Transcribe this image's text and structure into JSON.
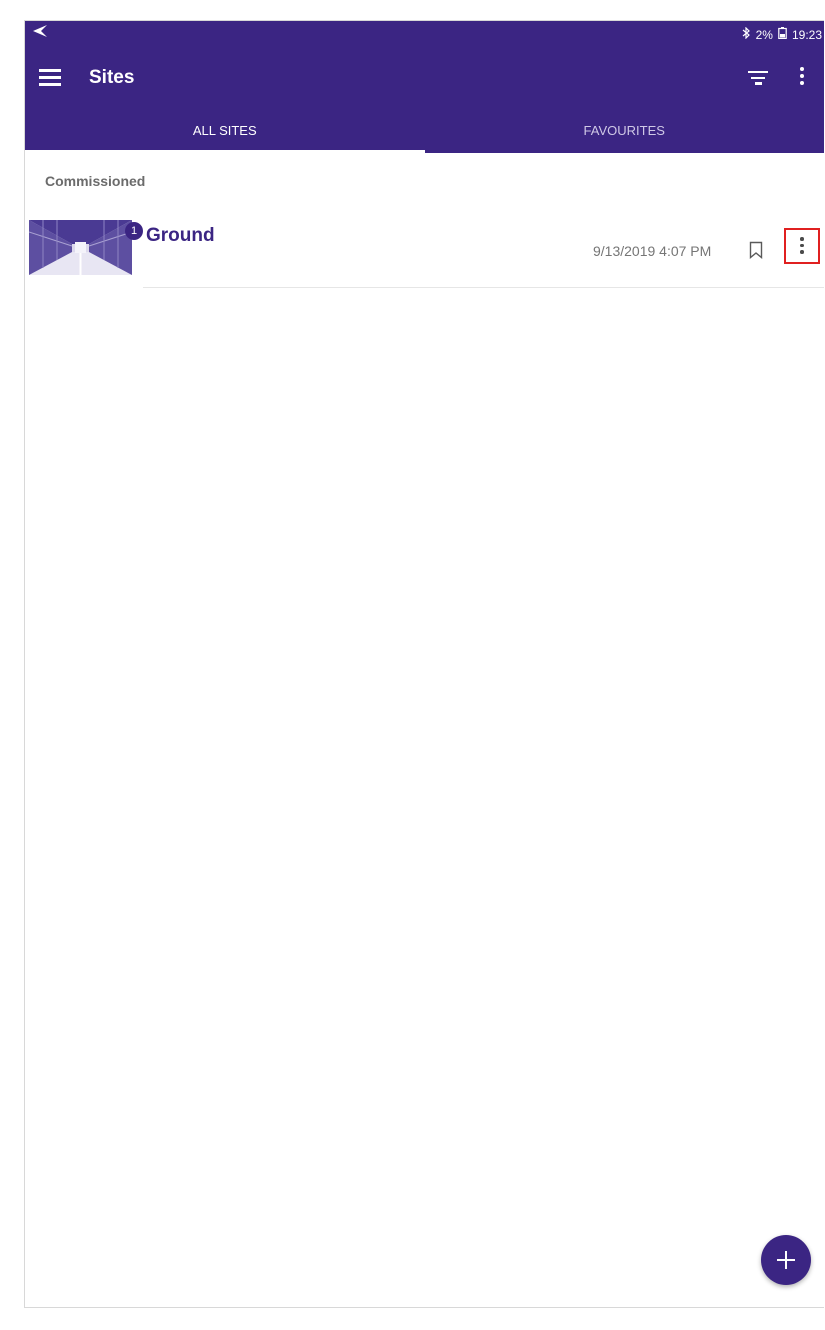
{
  "status_bar": {
    "battery": "2%",
    "time": "19:23",
    "icons": [
      "navigation-icon",
      "bluetooth-icon",
      "battery-icon"
    ]
  },
  "toolbar": {
    "title": "Sites",
    "icons": [
      "menu-icon",
      "filter-icon",
      "overflow-icon"
    ]
  },
  "tabs": [
    {
      "label": "ALL SITES",
      "active": true
    },
    {
      "label": "FAVOURITES",
      "active": false
    }
  ],
  "section": {
    "header": "Commissioned"
  },
  "sites": [
    {
      "name": "Ground",
      "badge": "1",
      "date": "9/13/2019 4:07 PM",
      "icons": [
        "bookmark-icon",
        "more-vert-icon"
      ]
    }
  ],
  "fab": {
    "icon": "add-icon"
  },
  "colors": {
    "primary": "#3b2583",
    "highlight": "#e02020",
    "secondary_text": "#757575"
  }
}
